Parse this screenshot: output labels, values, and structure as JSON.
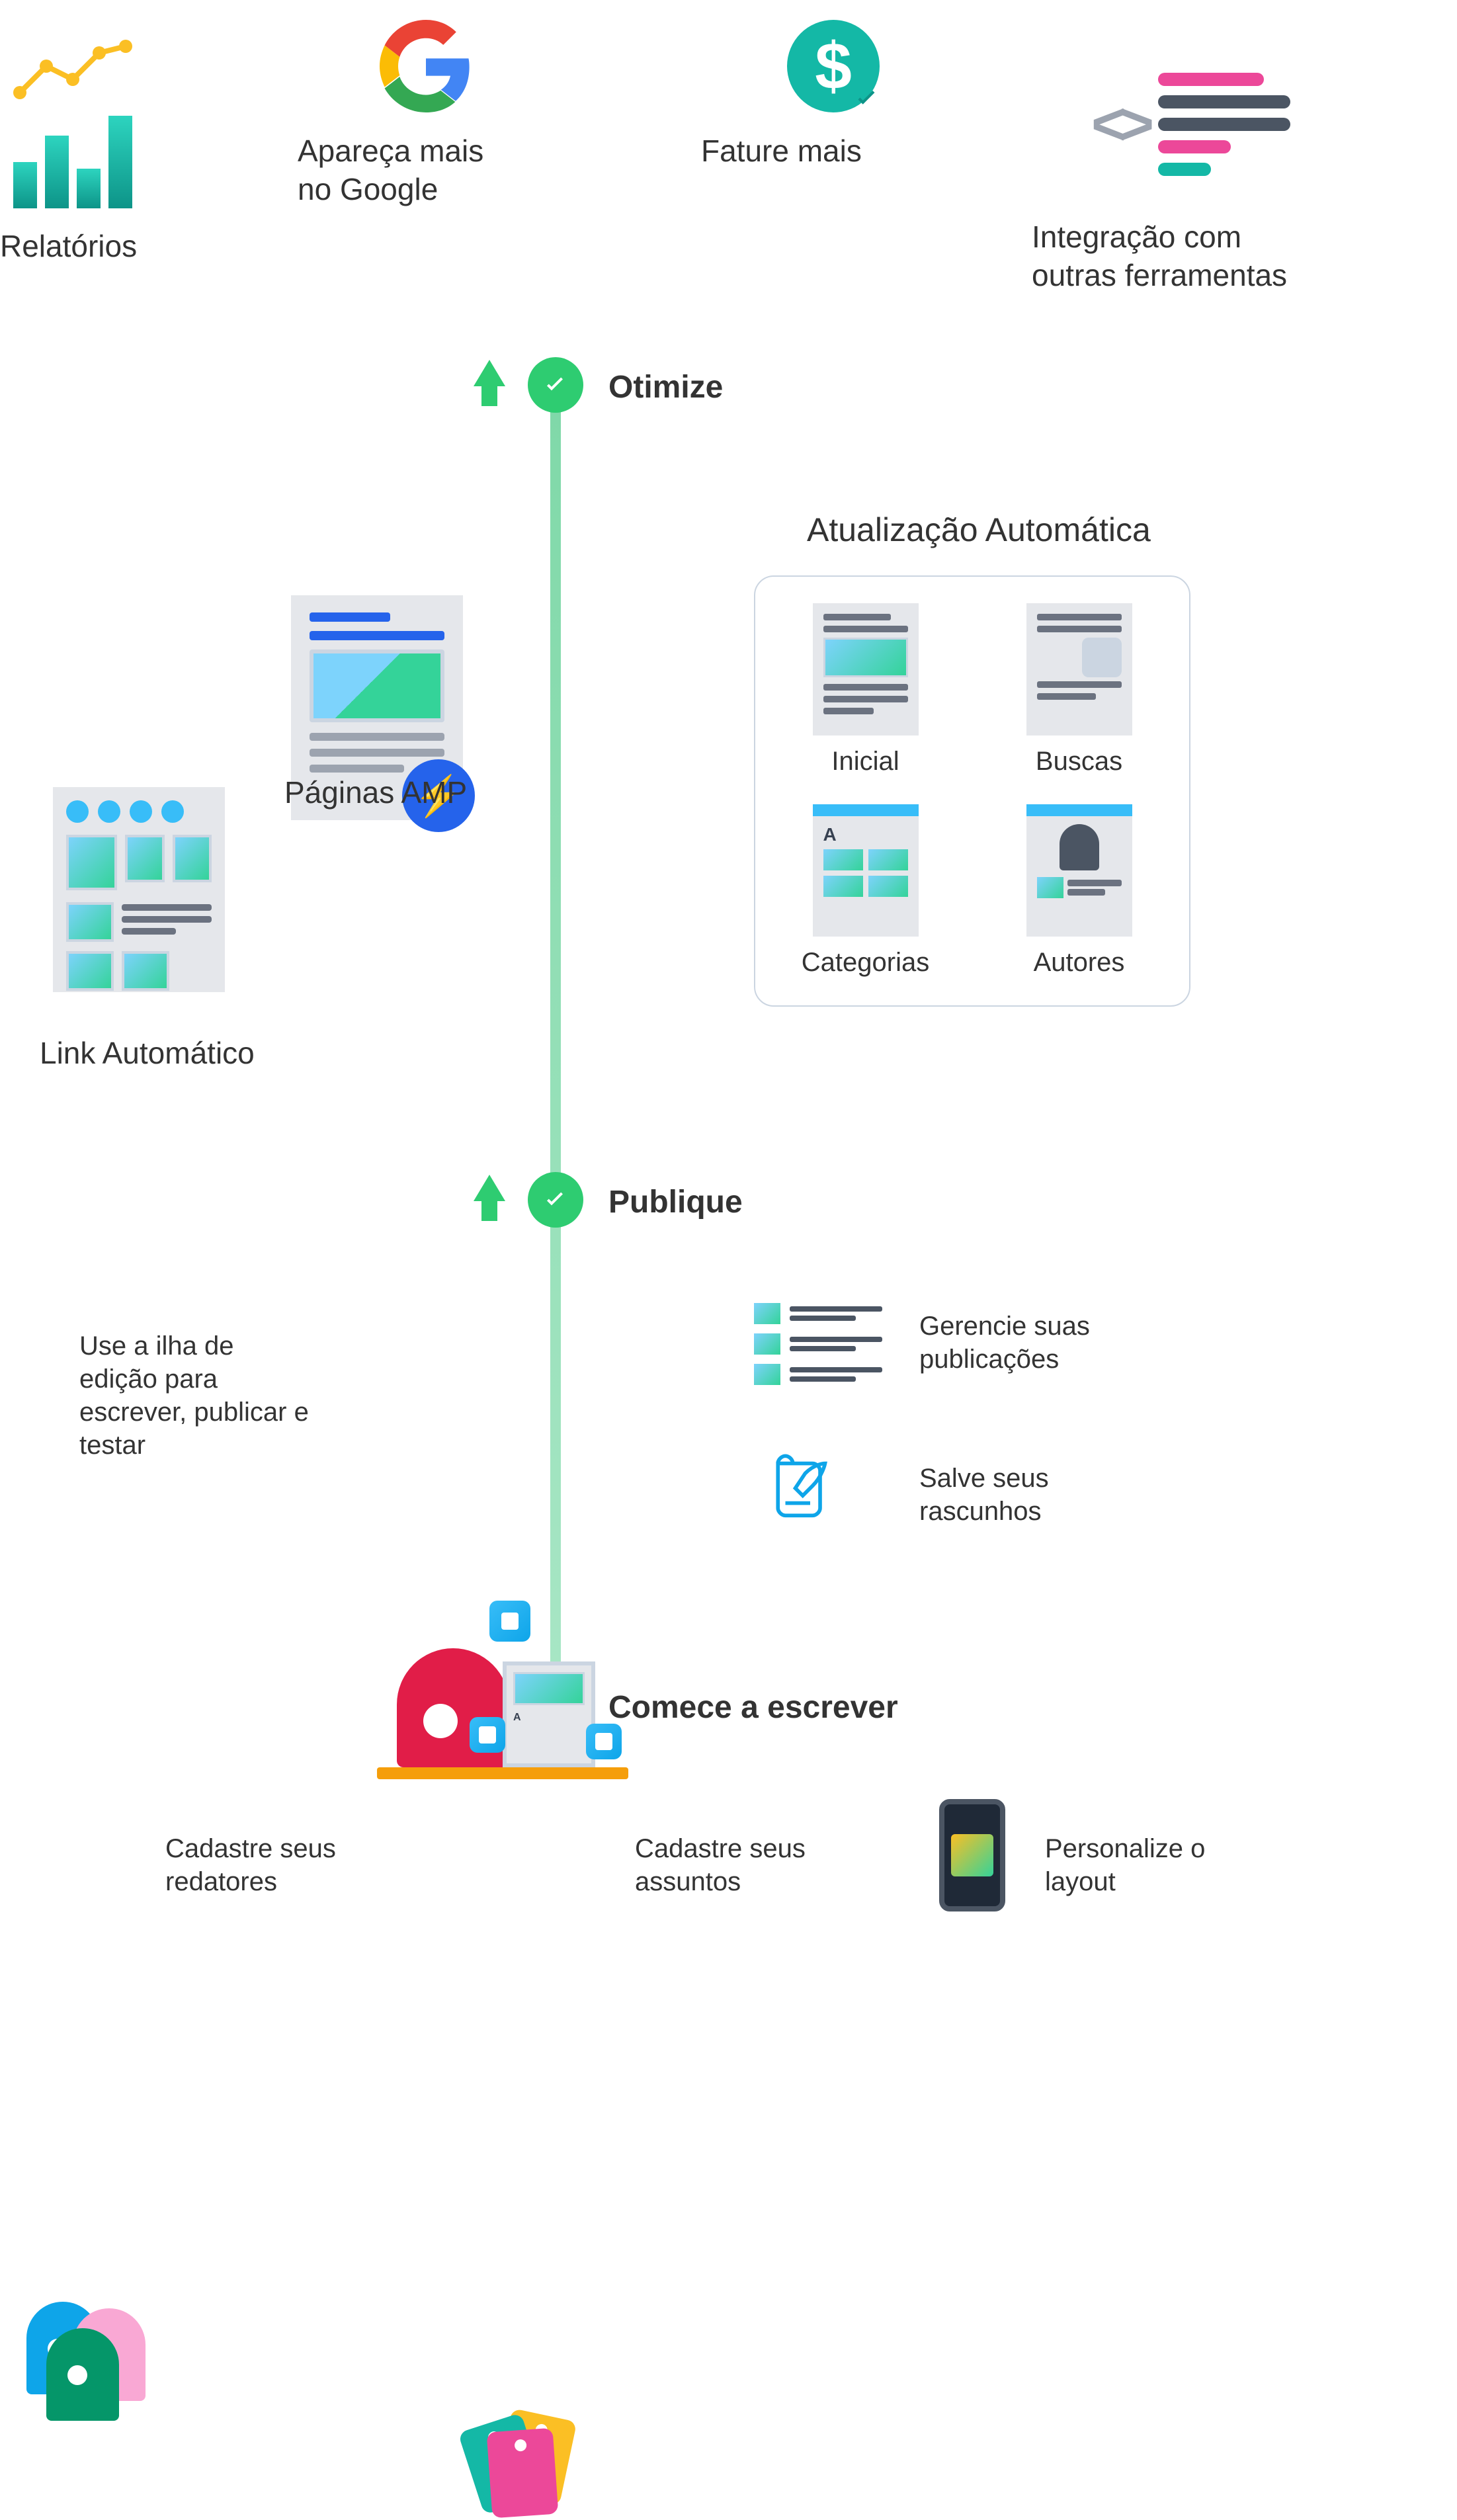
{
  "top": {
    "reports": "Relatórios",
    "google": "Apareça mais\nno Google",
    "revenue": "Fature mais",
    "integration": "Integração com\noutras ferramentas"
  },
  "stages": {
    "optimize": "Otimize",
    "publish": "Publique",
    "start": "Comece a escrever"
  },
  "amp_label": "Páginas AMP",
  "link_auto_label": "Link Automático",
  "auto_update": {
    "title": "Atualização Automática",
    "items": [
      "Inicial",
      "Buscas",
      "Categorias",
      "Autores"
    ]
  },
  "ilha_text": "Use a ilha de edição para escrever, publicar e testar",
  "manage_pubs": "Gerencie suas publicações",
  "save_drafts": "Salve seus rascunhos",
  "bottom": {
    "writers": "Cadastre seus redatores",
    "subjects": "Cadastre seus assuntos",
    "layout": "Personalize o layout"
  }
}
